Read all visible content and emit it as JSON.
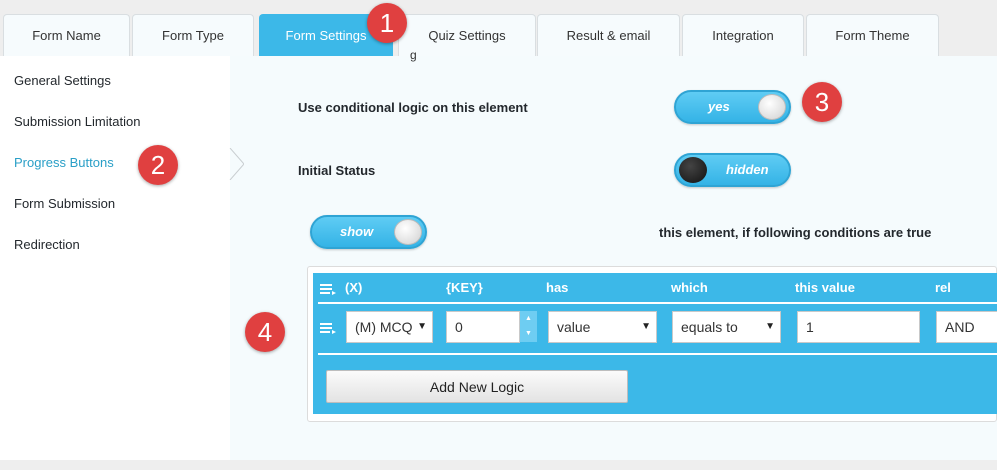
{
  "tabs": [
    {
      "label": "Form Name",
      "active": false
    },
    {
      "label": "Form Type",
      "active": false
    },
    {
      "label": "Form Settings",
      "active": true
    },
    {
      "label": "Quiz Settings",
      "active": false
    },
    {
      "label": "Result & email",
      "active": false
    },
    {
      "label": "Integration",
      "active": false
    },
    {
      "label": "Form Theme",
      "active": false
    }
  ],
  "sidebar": {
    "items": [
      {
        "label": "General Settings",
        "active": false
      },
      {
        "label": "Submission Limitation",
        "active": false
      },
      {
        "label": "Progress Buttons",
        "active": true
      },
      {
        "label": "Form Submission",
        "active": false
      },
      {
        "label": "Redirection",
        "active": false
      }
    ]
  },
  "content": {
    "conditional_label": "Use conditional logic on this element",
    "conditional_toggle": "yes",
    "initial_status_label": "Initial Status",
    "initial_status_toggle": "hidden",
    "show_toggle": "show",
    "show_suffix": "this element, if following conditions are true"
  },
  "logic_table": {
    "headers": [
      "(X)",
      "{KEY}",
      "has",
      "which",
      "this value",
      "rel"
    ],
    "row": {
      "element": "(M) MCQ",
      "key": "0",
      "has": "value",
      "which": "equals to",
      "value": "1",
      "rel": "AND"
    },
    "add_button": "Add New Logic"
  },
  "badges": [
    "1",
    "2",
    "3",
    "4"
  ],
  "colors": {
    "accent": "#3cb8e8",
    "active_nav_text": "#2a9fc7",
    "badge": "#e04040",
    "content_bg": "#f5fbfd"
  }
}
